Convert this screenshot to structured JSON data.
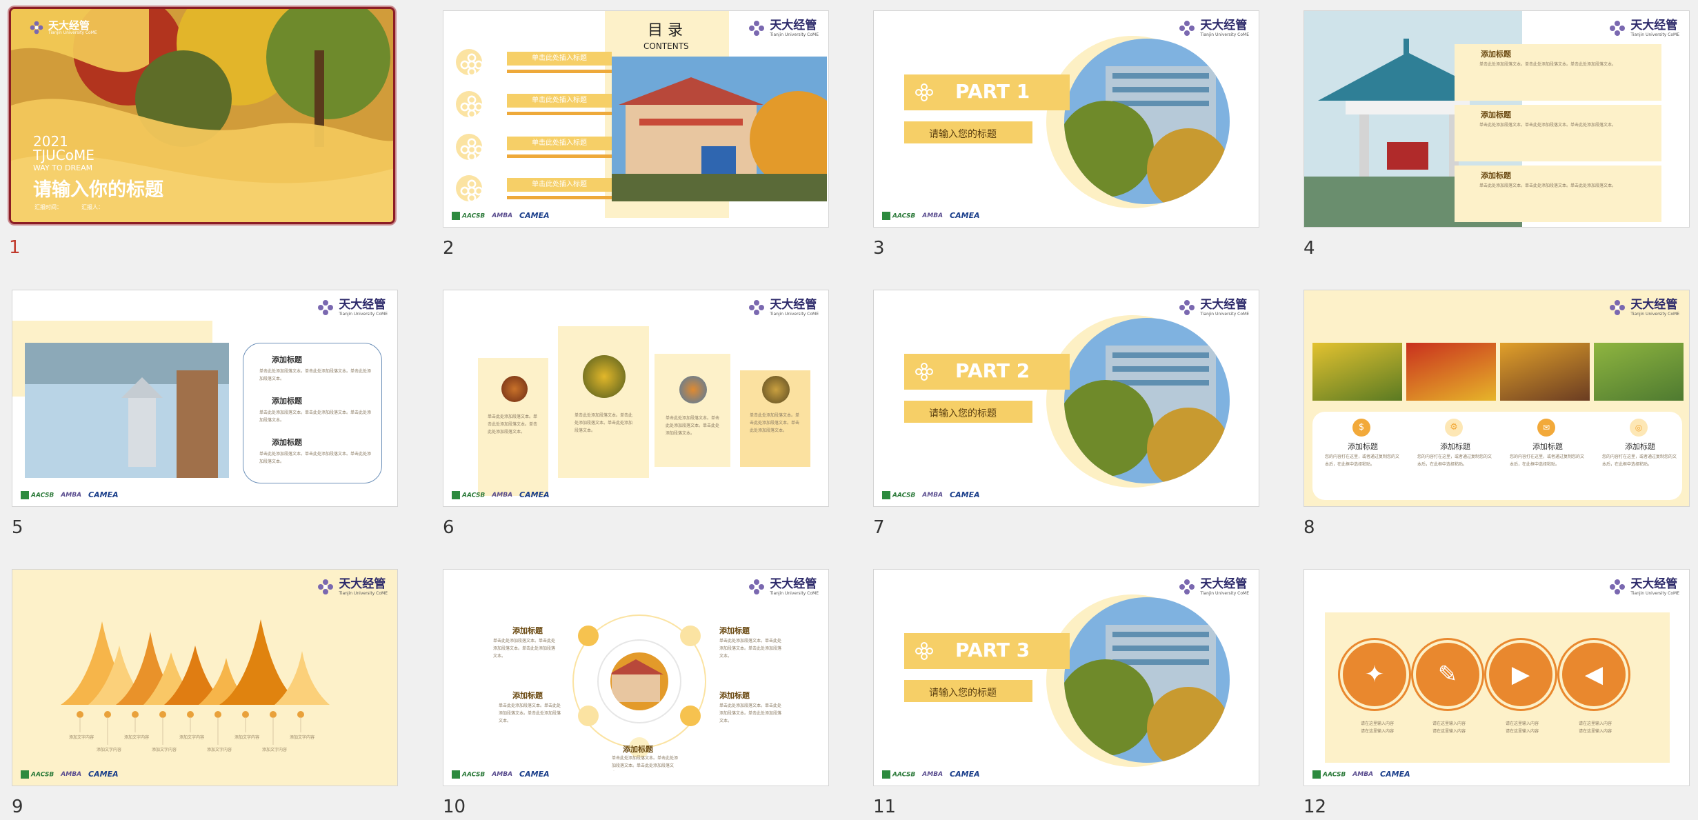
{
  "logo": {
    "cn": "天大经管",
    "en": "Tianjin University CoME"
  },
  "badges": [
    "AACSB",
    "AMBA",
    "CAMEA"
  ],
  "thumbnails": [
    {
      "number": "1"
    },
    {
      "number": "2"
    },
    {
      "number": "3"
    },
    {
      "number": "4"
    },
    {
      "number": "5"
    },
    {
      "number": "6"
    },
    {
      "number": "7"
    },
    {
      "number": "8"
    },
    {
      "number": "9"
    },
    {
      "number": "10"
    },
    {
      "number": "11"
    },
    {
      "number": "12"
    }
  ],
  "slide1": {
    "year": "2021",
    "brand": "TJUCoME",
    "tagline": "WAY TO DREAM",
    "title": "请输入你的标题",
    "meta_time": "汇报时间：",
    "meta_person": "汇报人："
  },
  "slide2": {
    "title": "目 录",
    "subtitle": "CONTENTS",
    "items": [
      "单击此处插入标题",
      "单击此处插入标题",
      "单击此处插入标题",
      "单击此处插入标题"
    ]
  },
  "part_slides": {
    "s3": {
      "part": "PART 1",
      "subtitle": "请输入您的标题"
    },
    "s7": {
      "part": "PART 2",
      "subtitle": "请输入您的标题"
    },
    "s11": {
      "part": "PART 3",
      "subtitle": "请输入您的标题"
    }
  },
  "generic": {
    "heading": "添加标题",
    "body": "单击此处添加段落文本。单击此处添加段落文本。单击此处添加段落文本。",
    "body2": "您的内容打在这里，或者通过复制您的文本后，在此框中选择粘贴。"
  },
  "slide9": {
    "label": "添加文字内容"
  },
  "slide12": {
    "line1": "请在这里输入内容",
    "line2": "请在这里输入内容"
  },
  "colors": {
    "accent": "#f6cf67",
    "pale": "#fdf1c9",
    "orange": "#e07d12",
    "selected_border": "#8b1c24"
  }
}
